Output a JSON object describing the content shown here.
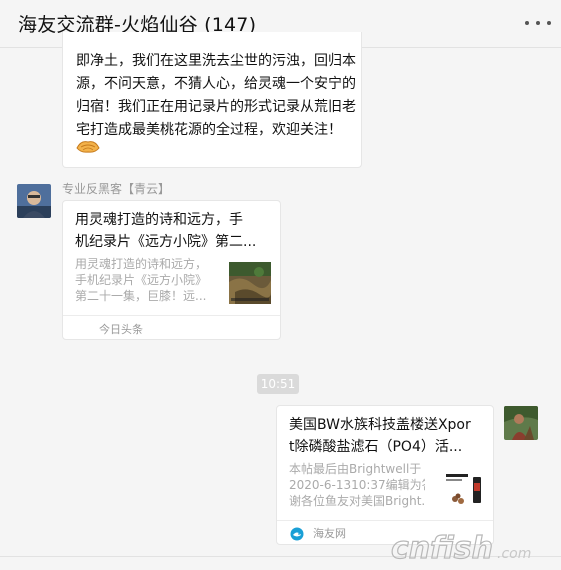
{
  "header": {
    "title": "海友交流群-火焰仙谷 (147)",
    "more_icon": "more-horizontal-icon"
  },
  "messages": [
    {
      "type": "text",
      "lines": [
        "即净土，我们在这里洗去尘世的污浊，回归本",
        "源，不问天意，不猜人心，给灵魂一个安宁的",
        "归宿！我们正在用记录片的形式记录从荒旧老",
        "宅打造成最美桃花源的全过程，欢迎关注！"
      ],
      "emoji": "handshake-emoji"
    },
    {
      "type": "card",
      "sender": "专业反黑客【青云】",
      "title_lines": [
        "用灵魂打造的诗和远方，手",
        "机纪录片《远方小院》第二..."
      ],
      "desc_lines": [
        "用灵魂打造的诗和远方，",
        "手机纪录片《远方小院》",
        "第二十一集，巨膝！远..."
      ],
      "source": "今日头条"
    },
    {
      "type": "timestamp",
      "text": "10:51"
    },
    {
      "type": "card",
      "sender": "",
      "title_lines": [
        "美国BW水族科技盖楼送Xpor",
        "t除磷酸盐滤石（PO4）活..."
      ],
      "desc_lines": [
        "本帖最后由Brightwell于",
        "2020-6-1310:37编辑为答",
        "谢各位鱼友对美国Bright..."
      ],
      "source": "海友网"
    }
  ],
  "watermark": {
    "text": "cnfish",
    "subtext": ".com"
  },
  "colors": {
    "background": "#f5f5f5",
    "bubble": "#ffffff",
    "meta_text": "#999999",
    "timestamp_bg": "#dadada"
  }
}
